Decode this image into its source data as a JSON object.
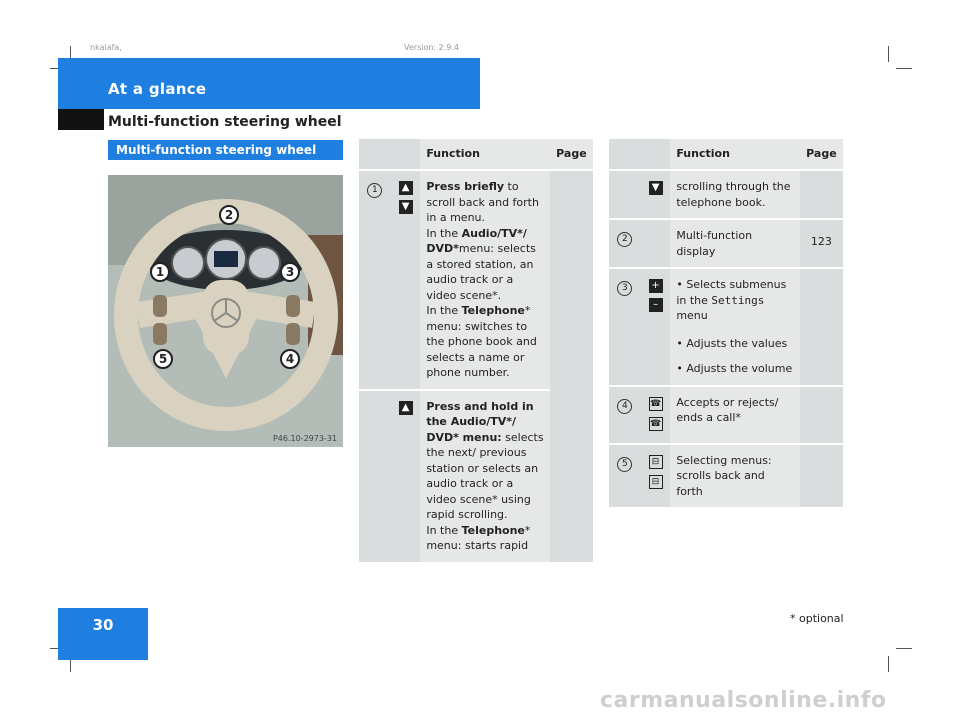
{
  "header": {
    "section_title": "At a glance",
    "page_subtitle": "Multi-function steering wheel",
    "meta_left": "nkalafa,",
    "meta_right": "Version: 2.9.4"
  },
  "figure": {
    "heading": "Multi-function steering wheel",
    "code": "P46.10-2973-31",
    "callouts": [
      "1",
      "2",
      "3",
      "4",
      "5"
    ]
  },
  "table_left": {
    "headers": {
      "function": "Function",
      "page": "Page"
    },
    "rows": [
      {
        "num": "1",
        "icons": [
          "▲",
          "▼"
        ],
        "text": [
          {
            "b": "Press briefly",
            "t": " to scroll back and forth in a menu."
          },
          {
            "pre": "In the ",
            "b": "Audio/TV*/ DVD*",
            "t": "menu: selects a stored station, an audio track or a video scene*."
          },
          {
            "pre": "In the ",
            "b": "Telephone",
            "t": "* menu: switches to the phone book and selects a name or phone number."
          }
        ],
        "page": ""
      },
      {
        "num": "",
        "icons": [
          "▲"
        ],
        "text": [
          {
            "b": "Press and hold in the Audio/TV*/ DVD* menu:",
            "t": " selects the next/ previous station or selects an audio track or a video scene* using rapid scrolling."
          },
          {
            "pre": "In the ",
            "b": "Telephone",
            "t": "* menu: starts rapid"
          }
        ],
        "page": ""
      }
    ]
  },
  "table_right": {
    "headers": {
      "function": "Function",
      "page": "Page"
    },
    "rows": [
      {
        "num": "",
        "icons": [
          "▼"
        ],
        "text": "scrolling through the telephone book.",
        "page": ""
      },
      {
        "num": "2",
        "icons": [],
        "text": "Multi-function display",
        "page": "123"
      },
      {
        "num": "3",
        "icons": [
          "+",
          "–"
        ],
        "text": "• Selects submenus in the ",
        "mono": "Settings",
        "text_after": " menu",
        "extra": [
          "• Adjusts the values",
          "• Adjusts the volume"
        ],
        "page": ""
      },
      {
        "num": "4",
        "icons": [
          "☎",
          "☎"
        ],
        "text": "Accepts or rejects/ ends a call*",
        "page": ""
      },
      {
        "num": "5",
        "icons": [
          "⊟",
          "⊟"
        ],
        "text": "Selecting menus: scrolls back and forth",
        "page": ""
      }
    ]
  },
  "footer": {
    "page_number": "30",
    "footnote": "* optional",
    "watermark": "carmanualsonline.info"
  }
}
